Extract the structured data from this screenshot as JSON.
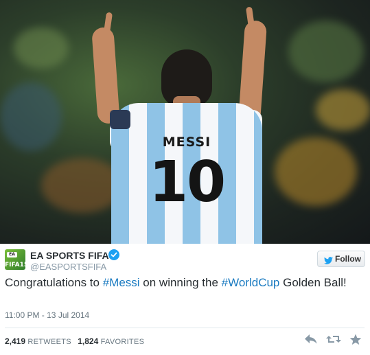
{
  "photo": {
    "jersey_name": "MESSI",
    "jersey_number": "10"
  },
  "tweet": {
    "avatar_badge": "EA",
    "avatar_text": "FIFA15",
    "display_name": "EA SPORTS FIFA",
    "handle": "@EASPORTSFIFA",
    "follow_label": "Follow",
    "text_before_tag1": "Congratulations to ",
    "hashtag1": "#Messi",
    "text_between": " on winning the ",
    "hashtag2": "#WorldCup",
    "text_after": " Golden Ball!",
    "timestamp": "11:00 PM - 13 Jul 2014",
    "retweets_count": "2,419",
    "retweets_label": "RETWEETS",
    "favorites_count": "1,824",
    "favorites_label": "FAVORITES"
  },
  "colors": {
    "hashtag": "#1b7bc1",
    "verified": "#1da1f2",
    "muted": "#8899a6"
  },
  "icons": [
    "verified-badge-icon",
    "twitter-bird-icon",
    "reply-icon",
    "retweet-icon",
    "favorite-star-icon"
  ]
}
